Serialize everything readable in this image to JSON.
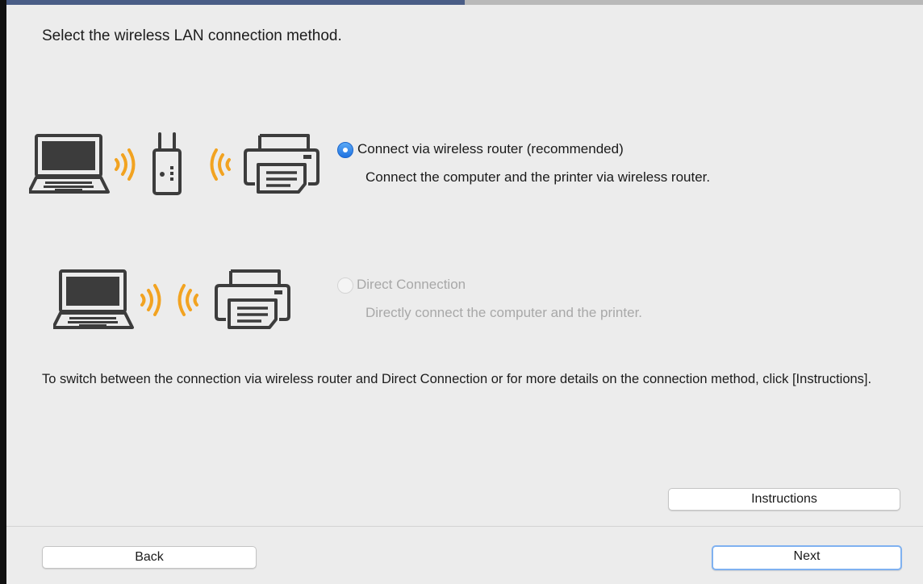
{
  "window": {
    "progress_fraction": 0.5,
    "heading": "Select the wireless LAN connection method."
  },
  "colors": {
    "accent": "#1f72e0",
    "wave": "#f2a321",
    "device_stroke": "#3c3c3c",
    "disabled_text": "#a8a8a8",
    "progress": "#4a5d86"
  },
  "options": [
    {
      "label": "Connect via wireless router (recommended)",
      "description": "Connect the computer and the printer via wireless router.",
      "selected": true,
      "enabled": true,
      "illustration": [
        "laptop-icon",
        "wifi-waves-icon",
        "router-icon",
        "wifi-waves-icon",
        "printer-icon"
      ]
    },
    {
      "label": "Direct Connection",
      "description": "Directly connect the computer and the printer.",
      "selected": false,
      "enabled": false,
      "illustration": [
        "laptop-icon",
        "wifi-waves-icon",
        "printer-icon"
      ]
    }
  ],
  "note": "To switch between the connection via wireless router and Direct Connection or for more details on the connection method, click [Instructions].",
  "buttons": {
    "instructions": "Instructions",
    "back": "Back",
    "next": "Next"
  }
}
